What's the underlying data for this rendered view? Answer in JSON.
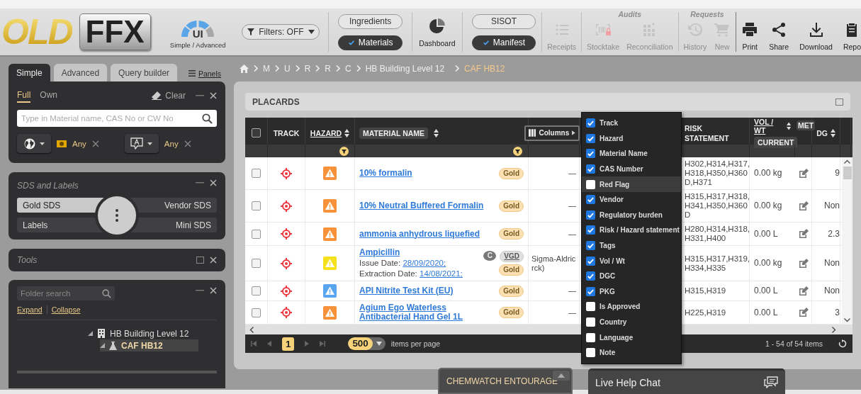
{
  "logo": {
    "text_a": "OLD",
    "text_b": "FFX"
  },
  "ui_switch": {
    "label": "UI",
    "caption": "Simple / Advanced",
    "level": 0.75
  },
  "filters": {
    "label": "Filters: OFF"
  },
  "scope_toggle": [
    {
      "label": "Ingredients",
      "selected": false
    },
    {
      "label": "Materials",
      "selected": true
    }
  ],
  "dashboard": {
    "label": "Dashboard"
  },
  "list_toggle": [
    {
      "label": "SISOT",
      "selected": false
    },
    {
      "label": "Manifest",
      "selected": true
    }
  ],
  "toolbar_groups": [
    {
      "items": [
        {
          "label": "Receipts",
          "kind": "list",
          "disabled": true
        }
      ]
    },
    {
      "title": "Audits",
      "items": [
        {
          "label": "Stocktake",
          "kind": "barcode",
          "disabled": true
        },
        {
          "label": "Reconciliation",
          "kind": "grid",
          "disabled": true
        }
      ]
    },
    {
      "title": "Requests",
      "items": [
        {
          "label": "History",
          "kind": "history",
          "disabled": true
        },
        {
          "label": "New",
          "kind": "cart",
          "disabled": true
        }
      ]
    },
    {
      "items": [
        {
          "label": "Print",
          "kind": "printer",
          "disabled": false
        },
        {
          "label": "Share",
          "kind": "share",
          "disabled": false
        },
        {
          "label": "Download",
          "kind": "download",
          "disabled": false
        },
        {
          "label": "Repo",
          "kind": "clipboard",
          "disabled": false
        }
      ]
    }
  ],
  "sidebar": {
    "tabs": [
      {
        "label": "Simple",
        "selected": true
      },
      {
        "label": "Advanced",
        "selected": false
      },
      {
        "label": "Query builder",
        "selected": false
      }
    ],
    "panels_link": "Panels",
    "search_panel": {
      "modes": [
        {
          "label": "Full",
          "selected": true
        },
        {
          "label": "Own",
          "selected": false
        }
      ],
      "clear": "Clear",
      "search": {
        "placeholder": "Type in Material name, CAS No or CW No"
      },
      "filters": [
        {
          "kind": "region",
          "value": "Any"
        },
        {
          "kind": "language",
          "value": "Any"
        }
      ]
    },
    "sds_panel": {
      "title": "SDS and Labels",
      "options": [
        {
          "label": "Gold SDS",
          "selected": true
        },
        {
          "label": "Vendor SDS",
          "selected": false
        },
        {
          "label": "Labels",
          "selected": false
        },
        {
          "label": "Mini SDS",
          "selected": false
        }
      ]
    },
    "tools_panel": {
      "title": "Tools"
    },
    "folder_panel": {
      "search": {
        "placeholder": "Folder search"
      },
      "links": [
        "Expand",
        "Collapse"
      ],
      "tree": [
        {
          "label": "HB Building Level 12",
          "kind": "building",
          "selected": false,
          "expanded": true,
          "children": [
            {
              "label": "CAF HB12",
              "kind": "lab",
              "selected": true,
              "expanded": true
            }
          ]
        }
      ]
    }
  },
  "breadcrumb": [
    {
      "label": "M",
      "current": false
    },
    {
      "label": "U",
      "current": false
    },
    {
      "label": "R",
      "current": false
    },
    {
      "label": "R",
      "current": false
    },
    {
      "label": "C",
      "current": false
    },
    {
      "label": "HB Building Level 12",
      "current": false
    },
    {
      "label": "CAF HB12",
      "current": true
    }
  ],
  "card": {
    "title": "PLACARDS"
  },
  "table": {
    "header": {
      "select_all_checked": false,
      "track": "TRACK",
      "hazard": "HAZARD",
      "material_name": "MATERIAL NAME",
      "columns_button": "Columns",
      "risk_statement": "RISK STATEMENT",
      "vol_wt": "VOL / WT",
      "vol_wt_sub": "CURRENT",
      "column_9": "MET",
      "dg": "DG"
    },
    "rows": [
      {
        "checked": false,
        "color": "#f7913a",
        "name": "10% formalin",
        "details": [],
        "tags": [
          {
            "label": "Gold",
            "kind": "gold"
          }
        ],
        "vendor_lines": [
          "—"
        ],
        "risk_lines": [
          "H302,H314,H317,",
          "H318,H350,H360",
          "D,H371"
        ],
        "vol": "0.00 kg",
        "dg": "9"
      },
      {
        "checked": false,
        "color": "#f7913a",
        "name": "10% Neutral Buffered Formalin",
        "details": [],
        "tags": [
          {
            "label": "Gold",
            "kind": "gold"
          }
        ],
        "vendor_lines": [
          "—"
        ],
        "risk_lines": [
          "H315,H317,H318,",
          "H341,H350,H360",
          "D"
        ],
        "vol": "0.00 kg",
        "dg": "Non"
      },
      {
        "checked": false,
        "color": "#f7913a",
        "name": "ammonia anhydrous liquefied",
        "details": [],
        "tags": [
          {
            "label": "Gold",
            "kind": "gold"
          }
        ],
        "vendor_lines": [
          "—"
        ],
        "risk_lines": [
          "H280,H314,H318,",
          "H331,H400"
        ],
        "vol": "0.00 L",
        "dg": "2.3"
      },
      {
        "checked": false,
        "color": "#f5e21c",
        "name": "Ampicillin",
        "details": [
          {
            "label": "Issue Date:",
            "date": "28/09/2020;"
          },
          {
            "label": "Extraction Date:",
            "date": "14/08/2021;"
          }
        ],
        "tags": [
          {
            "label": "C",
            "kind": "circle"
          },
          {
            "label": "VGD",
            "kind": "plain"
          },
          {
            "label": "Gold",
            "kind": "gold"
          }
        ],
        "vendor_lines": [
          "Sigma-Aldric",
          "rck)"
        ],
        "risk_lines": [
          "H315,H317,H319,",
          "H334,H335"
        ],
        "vol": "0.00 kg",
        "dg": "Non"
      },
      {
        "checked": false,
        "color": "#5aa5f0",
        "name": "API Nitrite Test Kit (EU)",
        "details": [],
        "tags": [
          {
            "label": "Gold",
            "kind": "gold"
          }
        ],
        "vendor_lines": [
          "—"
        ],
        "risk_lines": [
          "H315,H319"
        ],
        "vol": "0.00 L",
        "dg": "Non"
      },
      {
        "checked": false,
        "color": "#f7913a",
        "name": "Agium Ego Waterless Antibacterial Hand Gel 1L",
        "details": [],
        "tags": [
          {
            "label": "Gold",
            "kind": "gold"
          }
        ],
        "vendor_lines": [
          "—"
        ],
        "risk_lines": [
          "H225,H319"
        ],
        "vol": "0.00 L",
        "dg": "3"
      }
    ],
    "pager": {
      "page": "1",
      "page_size": "500",
      "page_size_label": "items per page",
      "summary": "1 - 54 of 54 items"
    }
  },
  "columns_menu": [
    {
      "label": "Track",
      "checked": true,
      "highlighted": false
    },
    {
      "label": "Hazard",
      "checked": true,
      "highlighted": false
    },
    {
      "label": "Material Name",
      "checked": true,
      "highlighted": false
    },
    {
      "label": "CAS Number",
      "checked": true,
      "highlighted": false
    },
    {
      "label": "Red Flag",
      "checked": false,
      "highlighted": true
    },
    {
      "label": "Vendor",
      "checked": true,
      "highlighted": false
    },
    {
      "label": "Regulatory burden",
      "checked": true,
      "highlighted": false
    },
    {
      "label": "Risk / Hazard statement",
      "checked": true,
      "highlighted": false
    },
    {
      "label": "Tags",
      "checked": true,
      "highlighted": false
    },
    {
      "label": "Vol / Wt",
      "checked": true,
      "highlighted": false
    },
    {
      "label": "DGC",
      "checked": true,
      "highlighted": false
    },
    {
      "label": "PKG",
      "checked": true,
      "highlighted": false
    },
    {
      "label": "Is Approved",
      "checked": false,
      "highlighted": false
    },
    {
      "label": "Country",
      "checked": false,
      "highlighted": false
    },
    {
      "label": "Language",
      "checked": false,
      "highlighted": false
    },
    {
      "label": "Note",
      "checked": false,
      "highlighted": false
    }
  ],
  "entourage": {
    "label": "CHEMWATCH ENTOURAGE"
  },
  "chat": {
    "label": "Live Help Chat"
  }
}
